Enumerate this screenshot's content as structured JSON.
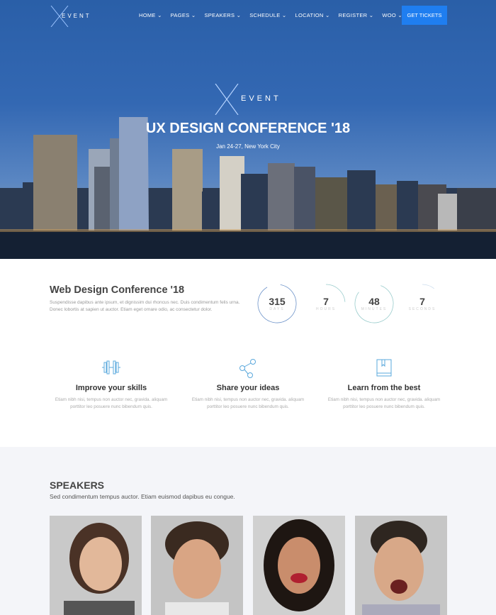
{
  "nav": {
    "logo": "EVENT",
    "items": [
      {
        "label": "HOME ⌄"
      },
      {
        "label": "PAGES ⌄"
      },
      {
        "label": "SPEAKERS ⌄"
      },
      {
        "label": "SCHEDULE ⌄"
      },
      {
        "label": "LOCATION ⌄"
      },
      {
        "label": "REGISTER ⌄"
      },
      {
        "label": "WOO ⌄"
      }
    ],
    "cta": "GET TICKETS",
    "cta_color": "#1f7ef0"
  },
  "hero": {
    "logo": "EVENT",
    "title": "UX DESIGN CONFERENCE '18",
    "date": "Jan 24-27, New York City"
  },
  "intro": {
    "title": "Web Design Conference '18",
    "text": "Suspendisse dapibus ante ipsum, et dignissim dui rhoncus nec. Duis condimentum felis urna. Donec lobortis at sapien ut auctor. Etiam eget ornare odio, ac consectetur dolor."
  },
  "countdown": [
    {
      "value": "315",
      "label": "DAYS"
    },
    {
      "value": "7",
      "label": "HOURS"
    },
    {
      "value": "48",
      "label": "MINUTES"
    },
    {
      "value": "7",
      "label": "SECONDS"
    }
  ],
  "features": [
    {
      "icon": "dumbbell-icon",
      "title": "Improve your skills",
      "text": "Etiam nibh nisi, tempus non auctor nec, gravida. aliquam porttitor leo posuere nunc bibendum quis."
    },
    {
      "icon": "share-icon",
      "title": "Share your ideas",
      "text": "Etiam nibh nisi, tempus non auctor nec, gravida. aliquam porttitor leo posuere nunc bibendum quis."
    },
    {
      "icon": "book-icon",
      "title": "Learn from the best",
      "text": "Etiam nibh nisi, tempus non auctor nec, gravida. aliquam porttitor leo posuere nunc bibendum quis."
    }
  ],
  "speakers": {
    "title": "SPEAKERS",
    "subtitle": "Sed condimentum tempus auctor. Etiam euismod dapibus eu congue."
  }
}
